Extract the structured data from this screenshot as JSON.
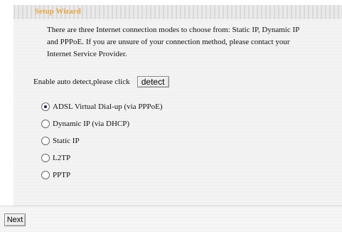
{
  "wizard": {
    "title": "Setup Wizard",
    "intro_lines": [
      "There are three Internet connection modes to choose from: Static IP, Dynamic IP",
      "and PPPoE. If you are unsure of your connection method, please contact your",
      "Internet Service Provider."
    ],
    "detect_label": "Enable auto detect,please click",
    "detect_button": "detect",
    "options": [
      {
        "label": "ADSL Virtual Dial-up (via PPPoE)",
        "selected": true
      },
      {
        "label": "Dynamic IP (via DHCP)",
        "selected": false
      },
      {
        "label": "Static IP",
        "selected": false
      },
      {
        "label": "L2TP",
        "selected": false
      },
      {
        "label": "PPTP",
        "selected": false
      }
    ],
    "next_button": "Next"
  },
  "colors": {
    "title_text": "#e8a640",
    "panel_background": "#f4f4f4"
  }
}
